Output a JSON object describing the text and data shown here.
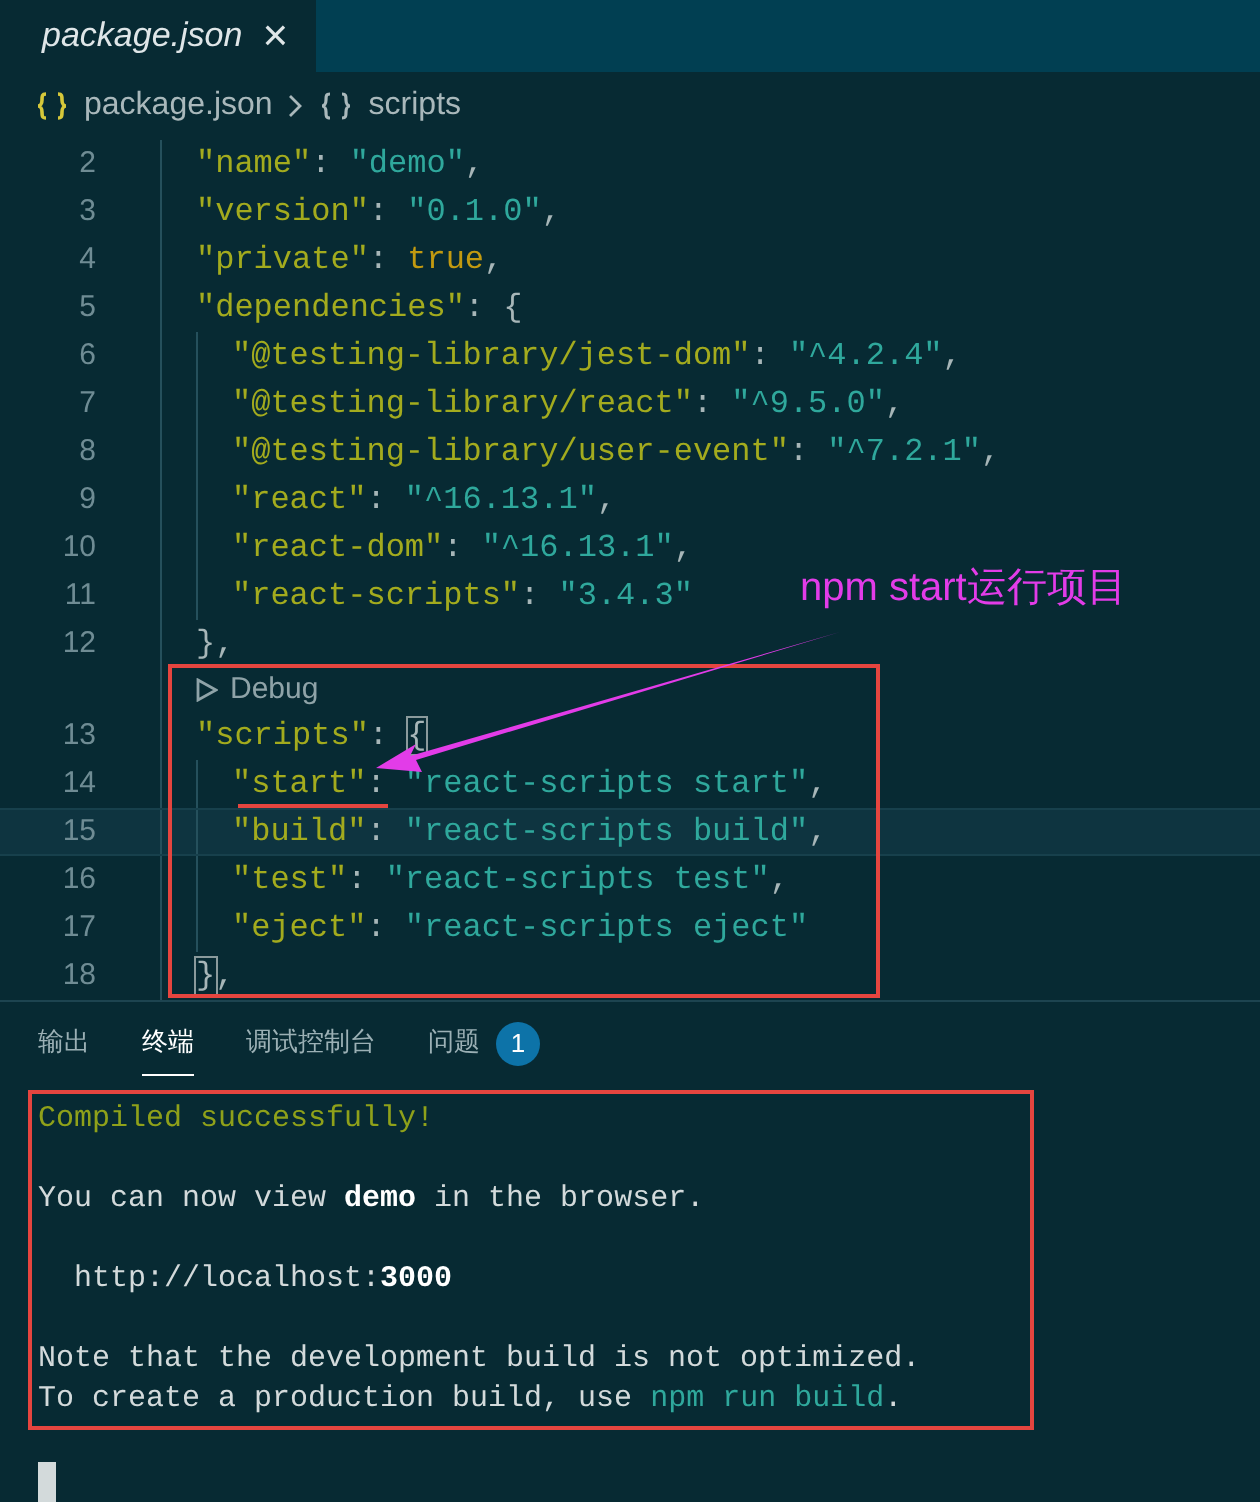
{
  "editor_tab": {
    "title": "package.json",
    "close": "×"
  },
  "breadcrumb": [
    {
      "text": "package.json"
    },
    {
      "text": "scripts"
    }
  ],
  "code": [
    {
      "kind": "line",
      "number": "2",
      "current": false,
      "tokens": [
        {
          "text": "\"name\"",
          "kind": "key"
        },
        {
          "text": ": ",
          "kind": "punct"
        },
        {
          "text": "\"demo\"",
          "kind": "string"
        },
        {
          "text": ",",
          "kind": "punct"
        }
      ]
    },
    {
      "kind": "line",
      "number": "3",
      "current": false,
      "tokens": [
        {
          "text": "\"version\"",
          "kind": "key"
        },
        {
          "text": ": ",
          "kind": "punct"
        },
        {
          "text": "\"0.1.0\"",
          "kind": "string"
        },
        {
          "text": ",",
          "kind": "punct"
        }
      ]
    },
    {
      "kind": "line",
      "number": "4",
      "current": false,
      "tokens": [
        {
          "text": "\"private\"",
          "kind": "key"
        },
        {
          "text": ": ",
          "kind": "punct"
        },
        {
          "text": "true",
          "kind": "literal"
        },
        {
          "text": ",",
          "kind": "punct"
        }
      ]
    },
    {
      "kind": "line",
      "number": "5",
      "current": false,
      "tokens": [
        {
          "text": "\"dependencies\"",
          "kind": "key"
        },
        {
          "text": ": {",
          "kind": "punct"
        }
      ],
      "children": [
        {
          "kind": "line",
          "number": "6",
          "current": false,
          "tokens": [
            {
              "text": "\"@testing-library/jest-dom\"",
              "kind": "key"
            },
            {
              "text": ": ",
              "kind": "punct"
            },
            {
              "text": "\"^4.2.4\"",
              "kind": "string"
            },
            {
              "text": ",",
              "kind": "punct"
            }
          ]
        },
        {
          "kind": "line",
          "number": "7",
          "current": false,
          "tokens": [
            {
              "text": "\"@testing-library/react\"",
              "kind": "key"
            },
            {
              "text": ": ",
              "kind": "punct"
            },
            {
              "text": "\"^9.5.0\"",
              "kind": "string"
            },
            {
              "text": ",",
              "kind": "punct"
            }
          ]
        },
        {
          "kind": "line",
          "number": "8",
          "current": false,
          "tokens": [
            {
              "text": "\"@testing-library/user-event\"",
              "kind": "key"
            },
            {
              "text": ": ",
              "kind": "punct"
            },
            {
              "text": "\"^7.2.1\"",
              "kind": "string"
            },
            {
              "text": ",",
              "kind": "punct"
            }
          ]
        },
        {
          "kind": "line",
          "number": "9",
          "current": false,
          "tokens": [
            {
              "text": "\"react\"",
              "kind": "key"
            },
            {
              "text": ": ",
              "kind": "punct"
            },
            {
              "text": "\"^16.13.1\"",
              "kind": "string"
            },
            {
              "text": ",",
              "kind": "punct"
            }
          ]
        },
        {
          "kind": "line",
          "number": "10",
          "current": false,
          "tokens": [
            {
              "text": "\"react-dom\"",
              "kind": "key"
            },
            {
              "text": ": ",
              "kind": "punct"
            },
            {
              "text": "\"^16.13.1\"",
              "kind": "string"
            },
            {
              "text": ",",
              "kind": "punct"
            }
          ]
        },
        {
          "kind": "line",
          "number": "11",
          "current": false,
          "tokens": [
            {
              "text": "\"react-scripts\"",
              "kind": "key"
            },
            {
              "text": ": ",
              "kind": "punct"
            },
            {
              "text": "\"3.4.3\"",
              "kind": "string"
            }
          ]
        }
      ]
    },
    {
      "kind": "line",
      "number": "12",
      "current": false,
      "tokens": [
        {
          "text": "},",
          "kind": "punct"
        }
      ]
    },
    {
      "kind": "codelens",
      "text": "Debug"
    },
    {
      "kind": "line",
      "number": "13",
      "current": false,
      "tokens": [
        {
          "text": "\"scripts\"",
          "kind": "key"
        },
        {
          "text": ": ",
          "kind": "punct"
        },
        {
          "text": "{",
          "kind": "bracket-match"
        }
      ],
      "children": [
        {
          "kind": "line",
          "number": "14",
          "current": false,
          "tokens": [
            {
              "text": "\"start\"",
              "kind": "key"
            },
            {
              "text": ": ",
              "kind": "punct"
            },
            {
              "text": "\"react-scripts start\"",
              "kind": "string"
            },
            {
              "text": ",",
              "kind": "punct"
            }
          ]
        },
        {
          "kind": "line",
          "number": "15",
          "current": true,
          "tokens": [
            {
              "text": "\"build\"",
              "kind": "key"
            },
            {
              "text": ": ",
              "kind": "punct"
            },
            {
              "text": "\"react-scripts build\"",
              "kind": "string"
            },
            {
              "text": ",",
              "kind": "punct"
            }
          ]
        },
        {
          "kind": "line",
          "number": "16",
          "current": false,
          "tokens": [
            {
              "text": "\"test\"",
              "kind": "key"
            },
            {
              "text": ": ",
              "kind": "punct"
            },
            {
              "text": "\"react-scripts test\"",
              "kind": "string"
            },
            {
              "text": ",",
              "kind": "punct"
            }
          ]
        },
        {
          "kind": "line",
          "number": "17",
          "current": false,
          "tokens": [
            {
              "text": "\"eject\"",
              "kind": "key"
            },
            {
              "text": ": ",
              "kind": "punct"
            },
            {
              "text": "\"react-scripts eject\"",
              "kind": "string"
            }
          ]
        }
      ]
    },
    {
      "kind": "line",
      "number": "18",
      "current": false,
      "tokens": [
        {
          "text": "}",
          "kind": "bracket-match"
        },
        {
          "text": ",",
          "kind": "punct"
        }
      ]
    }
  ],
  "annotation": {
    "text": "npm start运行项目"
  },
  "panel_tabs": [
    {
      "label": "输出",
      "selected": false
    },
    {
      "label": "终端",
      "selected": true
    },
    {
      "label": "调试控制台",
      "selected": false
    },
    {
      "label": "问题",
      "selected": false,
      "badge": "1"
    }
  ],
  "terminal": [
    [
      {
        "indented": false,
        "segments": [
          {
            "text": "Compiled successfully!",
            "kind": "success"
          }
        ]
      }
    ],
    [
      {
        "indented": false,
        "segments": [
          {
            "text": "You can now view ",
            "kind": "plain"
          },
          {
            "text": "demo",
            "kind": "bold"
          },
          {
            "text": " in the browser.",
            "kind": "plain"
          }
        ]
      }
    ],
    [
      {
        "indented": true,
        "segments": [
          {
            "text": "http://localhost:",
            "kind": "plain"
          },
          {
            "text": "3000",
            "kind": "bold"
          }
        ]
      }
    ],
    [
      {
        "indented": false,
        "segments": [
          {
            "text": "Note that the development build is not optimized.",
            "kind": "plain"
          }
        ]
      },
      {
        "indented": false,
        "segments": [
          {
            "text": "To create a production build, use ",
            "kind": "plain"
          },
          {
            "text": "npm run build",
            "kind": "link"
          },
          {
            "text": ".",
            "kind": "plain"
          }
        ]
      }
    ]
  ]
}
